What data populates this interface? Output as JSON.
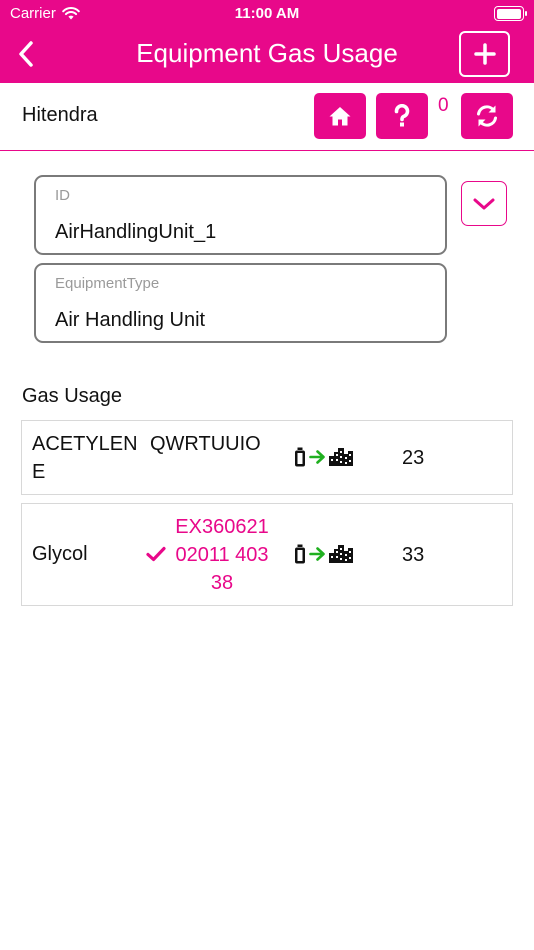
{
  "status_bar": {
    "carrier": "Carrier",
    "time": "11:00 AM"
  },
  "nav": {
    "title": "Equipment Gas Usage"
  },
  "user": {
    "name": "Hitendra",
    "count": "0"
  },
  "fields": {
    "id": {
      "label": "ID",
      "value": "AirHandlingUnit_1"
    },
    "equipment_type": {
      "label": "EquipmentType",
      "value": "Air Handling Unit"
    }
  },
  "gas_usage": {
    "title": "Gas Usage",
    "rows": [
      {
        "gas": "ACETYLENE",
        "code": "QWRTUUIO",
        "quantity": "23",
        "checked": false
      },
      {
        "gas": "Glycol",
        "code": "EX36062102011 40338",
        "quantity": "33",
        "checked": true
      }
    ]
  },
  "colors": {
    "accent": "#e8088a",
    "arrow": "#20b020",
    "border": "#7a7a7a"
  },
  "icons": [
    "back-chevron-icon",
    "plus-icon",
    "home-icon",
    "question-icon",
    "sync-icon",
    "chevron-down-icon",
    "check-icon",
    "cylinder-icon",
    "arrow-right-icon",
    "building-icon",
    "wifi-icon",
    "battery-icon"
  ]
}
